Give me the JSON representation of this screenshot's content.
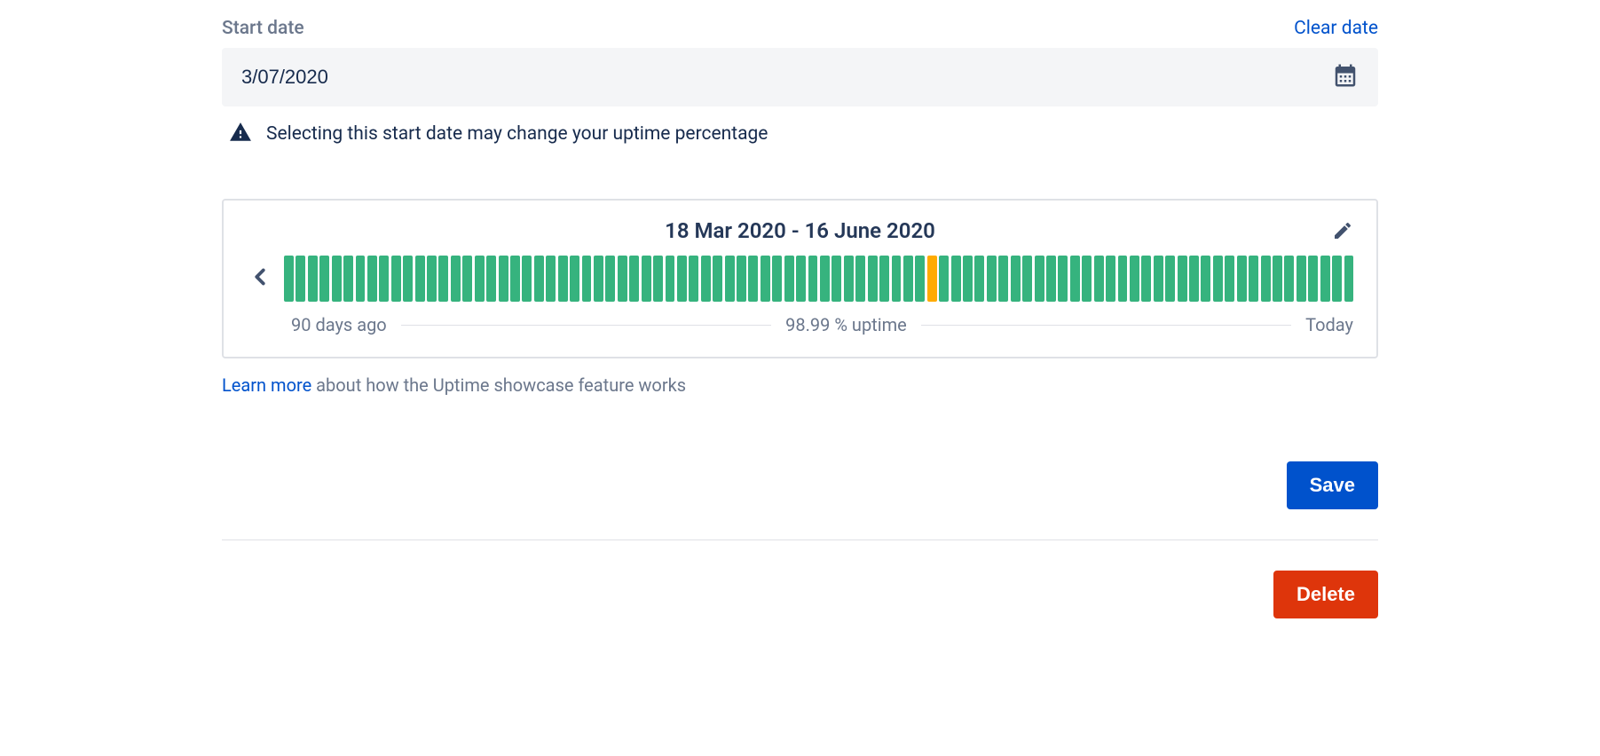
{
  "startDate": {
    "label": "Start date",
    "clearLabel": "Clear date",
    "value": "3/07/2020",
    "warning": "Selecting this start date may change your uptime percentage"
  },
  "uptime": {
    "range": "18 Mar 2020 - 16 June 2020",
    "legendLeft": "90 days ago",
    "legendCenter": "98.99 % uptime",
    "legendRight": "Today",
    "outageIndex": 54,
    "days": 90
  },
  "learnMore": {
    "linkText": "Learn more",
    "restText": " about how the Uptime showcase feature works"
  },
  "buttons": {
    "save": "Save",
    "delete": "Delete"
  }
}
